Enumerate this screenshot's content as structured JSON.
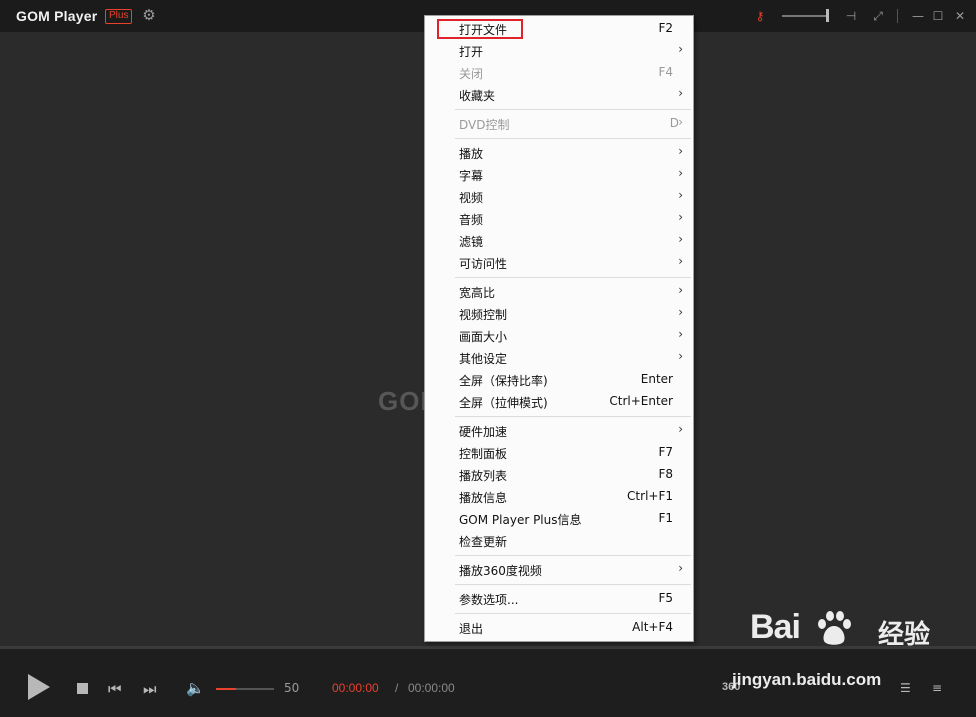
{
  "app": {
    "logo_text": "GOM Player",
    "badge": "Plus",
    "watermark": "GOM"
  },
  "titlebar": {
    "icons": [
      "gear-icon",
      "key-icon",
      "pin-icon",
      "fullscreen-icon",
      "minimize-icon",
      "maximize-icon",
      "close-icon"
    ],
    "volume_level": 1.0
  },
  "controls": {
    "volume_value": "50",
    "volume_fraction": 0.35,
    "time_current": "00:00:00",
    "time_separator": "/",
    "time_total": "00:00:00",
    "vr_label": "360",
    "accent_color": "#e8412c"
  },
  "menu": {
    "items": [
      {
        "label": "打开文件",
        "shortcut": "F2",
        "submenu": false,
        "disabled": false,
        "highlighted": true
      },
      {
        "label": "打开",
        "shortcut": "",
        "submenu": true,
        "disabled": false
      },
      {
        "label": "关闭",
        "shortcut": "F4",
        "submenu": false,
        "disabled": true
      },
      {
        "label": "收藏夹",
        "shortcut": "",
        "submenu": true,
        "disabled": false
      },
      {
        "label": "DVD控制",
        "shortcut": "D",
        "submenu": true,
        "disabled": true
      },
      {
        "label": "播放",
        "shortcut": "",
        "submenu": true,
        "disabled": false
      },
      {
        "label": "字幕",
        "shortcut": "",
        "submenu": true,
        "disabled": false
      },
      {
        "label": "视频",
        "shortcut": "",
        "submenu": true,
        "disabled": false
      },
      {
        "label": "音频",
        "shortcut": "",
        "submenu": true,
        "disabled": false
      },
      {
        "label": "滤镜",
        "shortcut": "",
        "submenu": true,
        "disabled": false
      },
      {
        "label": "可访问性",
        "shortcut": "",
        "submenu": true,
        "disabled": false
      },
      {
        "label": "宽高比",
        "shortcut": "",
        "submenu": true,
        "disabled": false
      },
      {
        "label": "视频控制",
        "shortcut": "",
        "submenu": true,
        "disabled": false
      },
      {
        "label": "画面大小",
        "shortcut": "",
        "submenu": true,
        "disabled": false
      },
      {
        "label": "其他设定",
        "shortcut": "",
        "submenu": true,
        "disabled": false
      },
      {
        "label": "全屏（保持比率)",
        "shortcut": "Enter",
        "submenu": false,
        "disabled": false
      },
      {
        "label": "全屏（拉伸模式)",
        "shortcut": "Ctrl+Enter",
        "submenu": false,
        "disabled": false
      },
      {
        "label": "硬件加速",
        "shortcut": "",
        "submenu": true,
        "disabled": false
      },
      {
        "label": "控制面板",
        "shortcut": "F7",
        "submenu": false,
        "disabled": false
      },
      {
        "label": "播放列表",
        "shortcut": "F8",
        "submenu": false,
        "disabled": false
      },
      {
        "label": "播放信息",
        "shortcut": "Ctrl+F1",
        "submenu": false,
        "disabled": false
      },
      {
        "label": "GOM Player Plus信息",
        "shortcut": "F1",
        "submenu": false,
        "disabled": false
      },
      {
        "label": "检查更新",
        "shortcut": "",
        "submenu": false,
        "disabled": false
      },
      {
        "label": "播放360度视频",
        "shortcut": "",
        "submenu": true,
        "disabled": false
      },
      {
        "label": "参数选项...",
        "shortcut": "F5",
        "submenu": false,
        "disabled": false
      },
      {
        "label": "退出",
        "shortcut": "Alt+F4",
        "submenu": false,
        "disabled": false
      }
    ]
  },
  "watermark": {
    "brand": "Bai",
    "brand2": "du",
    "product": "经验",
    "url": "jingyan.baidu.com"
  }
}
